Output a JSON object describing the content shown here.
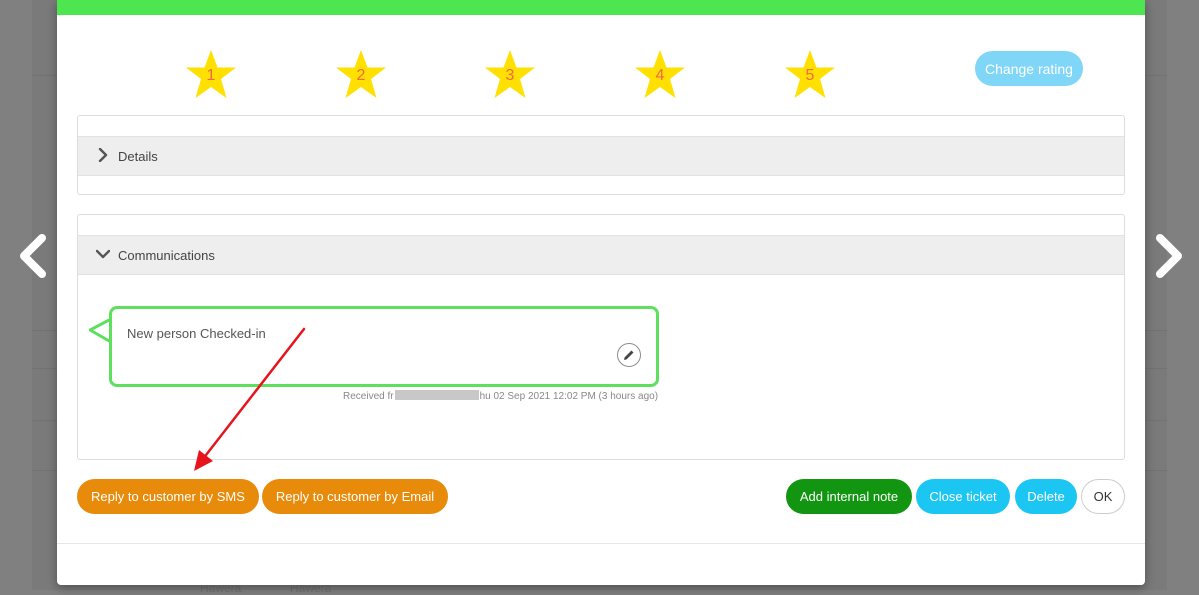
{
  "navigation": {
    "previous_icon": "chevron-left-icon",
    "next_icon": "chevron-right-icon"
  },
  "rating": {
    "stars": [
      {
        "label": "1"
      },
      {
        "label": "2"
      },
      {
        "label": "3"
      },
      {
        "label": "4"
      },
      {
        "label": "5"
      }
    ],
    "change_label": "Change rating"
  },
  "details_panel": {
    "title": "Details",
    "icon": "chevron-right-icon",
    "expanded": false
  },
  "communications_panel": {
    "title": "Communications",
    "icon": "chevron-down-icon",
    "expanded": true,
    "messages": [
      {
        "text": "New person Checked-in",
        "meta_prefix": "Received fr",
        "meta_suffix": "hu 02 Sep 2021 12:02 PM (3 hours ago)",
        "edit_icon": "pencil-icon"
      }
    ]
  },
  "actions": {
    "reply_sms": "Reply to customer by SMS",
    "reply_email": "Reply to customer by Email",
    "add_note": "Add internal note",
    "close_ticket": "Close ticket",
    "delete": "Delete",
    "ok": "OK"
  },
  "background": {
    "row_texts": [
      "Hawera",
      "Hawera"
    ]
  },
  "colors": {
    "header_green": "#4de650",
    "star_yellow": "#ffe000",
    "star_number": "#f06a4a",
    "change_rating": "#7fd6f7",
    "reply_orange": "#e88a0a",
    "note_green": "#129612",
    "action_blue": "#1cc6f3",
    "bubble_border": "#5ee05e",
    "annotation_arrow": "#e8141c"
  }
}
